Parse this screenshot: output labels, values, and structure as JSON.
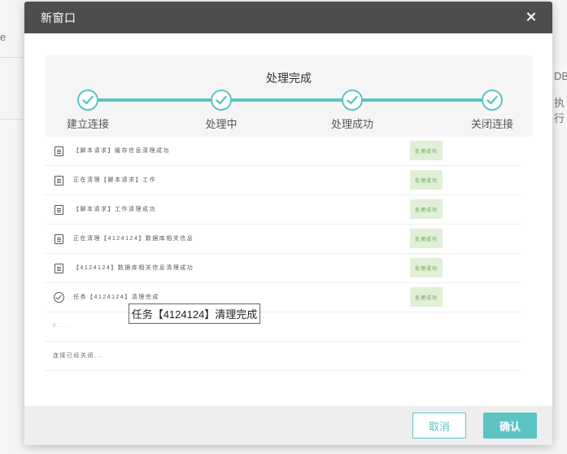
{
  "background": {
    "frag_db": "DB",
    "frag_exec": "执行",
    "frag_left": "e"
  },
  "modal": {
    "title": "新窗口",
    "close_icon": "close-icon"
  },
  "stepper": {
    "title": "处理完成",
    "accent_color": "#5bc4c2",
    "steps": [
      {
        "label": "建立连接",
        "done": true
      },
      {
        "label": "处理中",
        "done": true
      },
      {
        "label": "处理成功",
        "done": true
      },
      {
        "label": "关闭连接",
        "done": true
      }
    ]
  },
  "logs": [
    {
      "icon": "document-icon",
      "text": "【脚本请求】缓存信息清理成功",
      "status": "处理成功"
    },
    {
      "icon": "document-icon",
      "text": "正在清理【脚本请求】工作",
      "status": "处理成功"
    },
    {
      "icon": "document-icon",
      "text": "【脚本请求】工作清理成功",
      "status": "处理成功"
    },
    {
      "icon": "document-icon",
      "text": "正在清理【4124124】数据库相关信息",
      "status": "处理成功"
    },
    {
      "icon": "document-icon",
      "text": "【4124124】数据库相关信息清理成功",
      "status": "处理成功"
    },
    {
      "icon": "check-circle-icon",
      "text": "任务【4124124】清理完成",
      "status": "处理成功"
    },
    {
      "icon": "",
      "text": "0......",
      "status": ""
    },
    {
      "icon": "",
      "text": "连接已经关闭...",
      "status": ""
    }
  ],
  "tooltip": {
    "text": "任务【4124124】清理完成"
  },
  "footer": {
    "cancel_label": "取消",
    "confirm_label": "确认",
    "status_badge_color": "#e0f0d6"
  }
}
